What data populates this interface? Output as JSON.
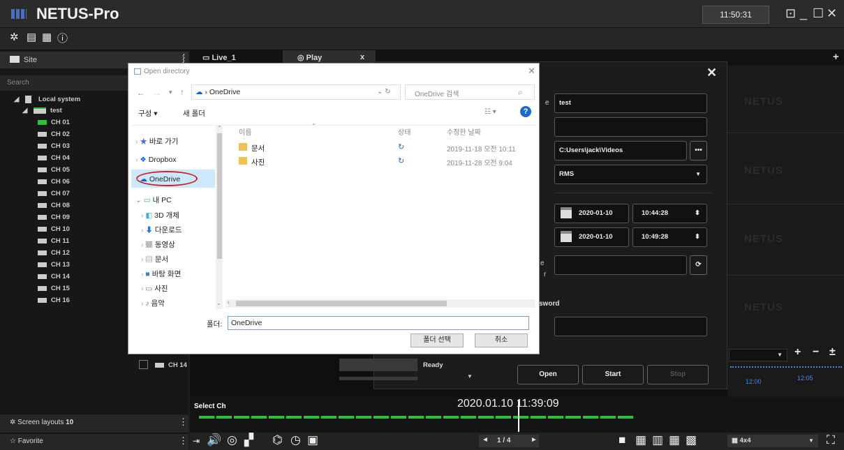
{
  "app": {
    "title": "NETUS-Pro",
    "clock": "11:50:31"
  },
  "window_controls": {
    "restore": "⊡",
    "minimize": "_",
    "maximize": "☐",
    "close": "✕"
  },
  "toolbar_icons": [
    "gear-icon",
    "calendar-icon",
    "grid-icon",
    "info-icon"
  ],
  "left": {
    "site_label": "Site",
    "search_label": "Search",
    "tree_root": "Local system",
    "tree_device": "test",
    "channels": [
      "CH 01",
      "CH 02",
      "CH 03",
      "CH 04",
      "CH 05",
      "CH 06",
      "CH 07",
      "CH 08",
      "CH 09",
      "CH 10",
      "CH 11",
      "CH 12",
      "CH 13",
      "CH 14",
      "CH 15",
      "CH 16"
    ],
    "screen_layouts_label": "Screen layouts",
    "screen_layouts_count": "10",
    "favorite_label": "Favorite"
  },
  "tabs": {
    "live": "Live_1",
    "play": "Play",
    "close": "x",
    "add": "+"
  },
  "watermark": "NETUS",
  "dark_dialog": {
    "name_value": "test",
    "path_value": "C:Users\\jack\\Videos",
    "path_button": "•••",
    "format_value": "RMS",
    "start_date": "2020-01-10",
    "start_time": "10:44:28",
    "end_date": "2020-01-10",
    "end_time": "10:49:28",
    "password_label": "sword",
    "e_label": "e",
    "r_label": "r",
    "open_btn": "Open",
    "start_btn": "Start",
    "stop_btn": "Stop"
  },
  "open_dir": {
    "title": "Open directory",
    "address": "OneDrive",
    "search_placeholder": "OneDrive 검색",
    "organize": "구성 ▾",
    "new_folder": "새 폴더",
    "nav": {
      "quick": "바로 가기",
      "dropbox": "Dropbox",
      "onedrive": "OneDrive",
      "pc": "내 PC",
      "obj3d": "3D 개체",
      "downloads": "다운로드",
      "videos": "동영상",
      "docs": "문서",
      "desktop": "바탕 화면",
      "pictures": "사진",
      "music": "음악"
    },
    "columns": {
      "name": "이름",
      "status": "상태",
      "modified": "수정한 날짜"
    },
    "files": [
      {
        "name": "문서",
        "date": "2019-11-18 오전 10:11"
      },
      {
        "name": "사진",
        "date": "2019-11-28 오전 9:04"
      }
    ],
    "folder_label": "폴더:",
    "folder_value": "OneDrive",
    "select_btn": "폴더 선택",
    "cancel_btn": "취소"
  },
  "list_row": {
    "channel": "CH 14",
    "status": "Ready"
  },
  "timeline": {
    "select_ch": "Select Ch",
    "datetime": "2020.01.10  11:39:09",
    "t1": "12:00",
    "t2": "12:05"
  },
  "paging": {
    "text": "1  /  4"
  },
  "layout_select": "4x4",
  "colors": {
    "accent_green": "#2fbf3a",
    "onedrive_blue": "#0b64c8",
    "highlight_red": "#d02020"
  }
}
